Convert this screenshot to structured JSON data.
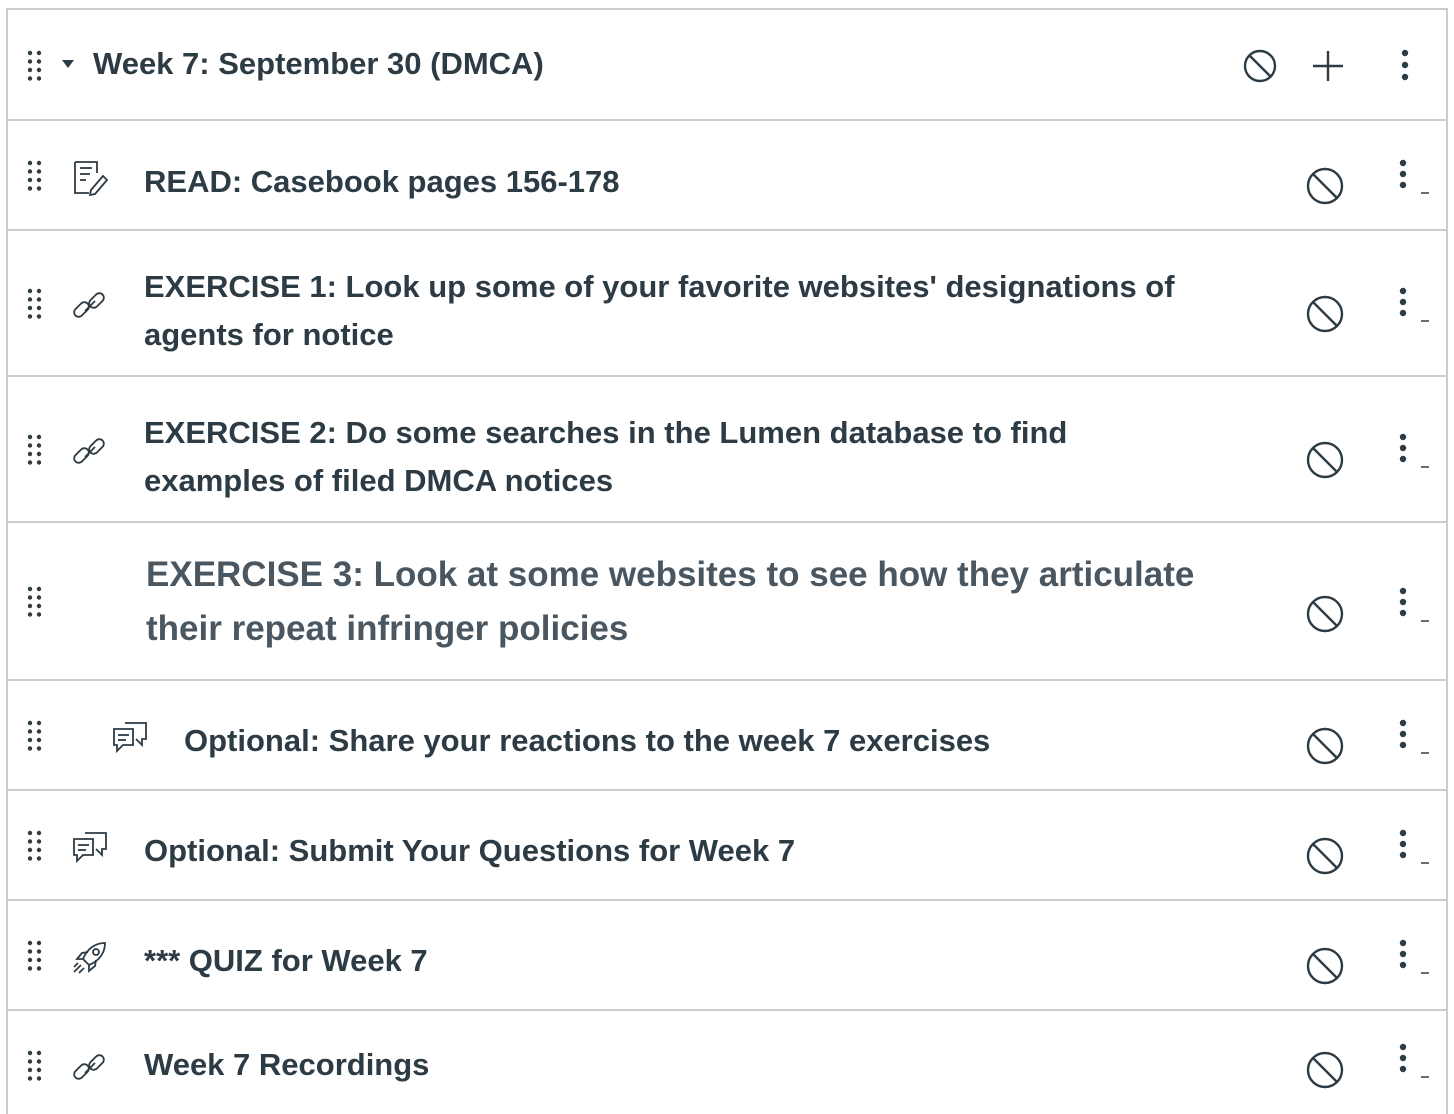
{
  "module": {
    "title": "Week 7: September 30 (DMCA)",
    "header_icons": [
      "drag-handle-icon",
      "caret-down-icon",
      "unpublished-icon",
      "plus-icon",
      "kebab-menu-icon"
    ]
  },
  "items": [
    {
      "type": "assignment",
      "icon": "assignment-icon",
      "title": "READ: Casebook pages 156-178"
    },
    {
      "type": "link",
      "icon": "link-icon",
      "title": "EXERCISE 1: Look up some of your favorite websites' designations of agents for notice"
    },
    {
      "type": "link",
      "icon": "link-icon",
      "title": "EXERCISE 2: Do some searches in the Lumen database to find examples of filed DMCA notices"
    },
    {
      "type": "subheader",
      "icon": "",
      "title": "EXERCISE 3: Look at some websites to see how they articulate their repeat infringer policies"
    },
    {
      "type": "discussion",
      "icon": "discussion-icon",
      "title": "Optional: Share your reactions to the week 7 exercises",
      "indented": true
    },
    {
      "type": "discussion",
      "icon": "discussion-icon",
      "title": "Optional: Submit Your Questions for Week 7"
    },
    {
      "type": "quiz",
      "icon": "quiz-rocket-icon",
      "title": "*** QUIZ for Week 7"
    },
    {
      "type": "link",
      "icon": "link-icon",
      "title": "Week 7 Recordings"
    }
  ],
  "colors": {
    "text": "#2d3b45",
    "subheader_text": "#4a5761",
    "border": "#c7cdd1",
    "icon": "#2d3b45"
  }
}
